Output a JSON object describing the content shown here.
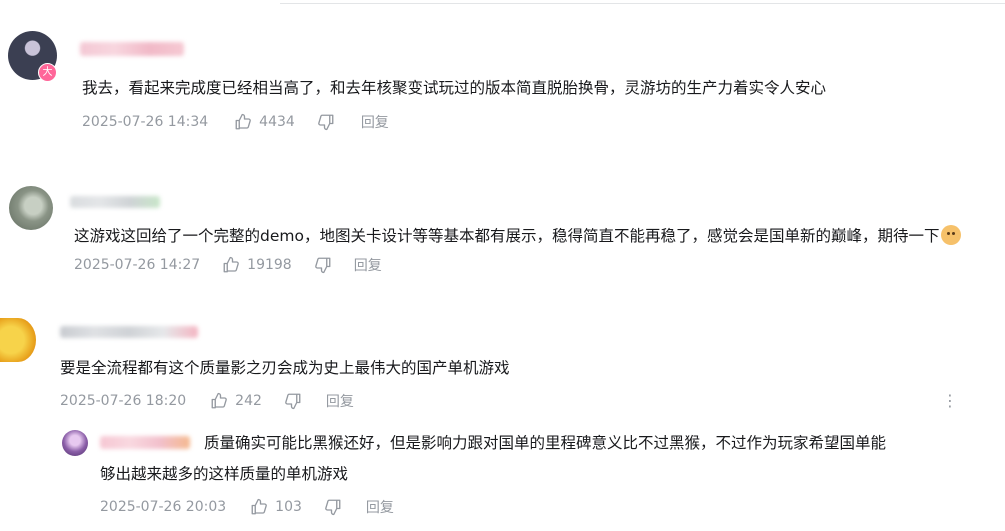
{
  "comments": [
    {
      "text": "我去，看起来完成度已经相当高了，和去年核聚变试玩过的版本简直脱胎换骨，灵游坊的生产力着实令人安心",
      "time": "2025-07-26 14:34",
      "likes": "4434",
      "reply_label": "回复",
      "badge": "大",
      "avatar_color": "#3b3f52"
    },
    {
      "text": "这游戏这回给了一个完整的demo，地图关卡设计等等基本都有展示，稳得简直不能再稳了，感觉会是国单新的巅峰，期待一下",
      "time": "2025-07-26 14:27",
      "likes": "19198",
      "reply_label": "回复",
      "avatar_color": "#8a9486"
    },
    {
      "text": "要是全流程都有这个质量影之刃会成为史上最伟大的国产单机游戏",
      "time": "2025-07-26 18:20",
      "likes": "242",
      "reply_label": "回复",
      "avatar_color": "#f2c12e"
    }
  ],
  "reply": {
    "text_line1": "质量确实可能比黑猴还好，但是影响力跟对国单的里程碑意义比不过黑猴，不过作为玩家希望国单能",
    "text_line2": "够出越来越多的这样质量的单机游戏",
    "time": "2025-07-26 20:03",
    "likes": "103",
    "reply_label": "回复",
    "avatar_color": "#8b5fa8"
  },
  "more_icon": "⋮",
  "colors": {
    "meta": "#9499a0",
    "text": "#18191c",
    "badge": "#ff6699"
  }
}
